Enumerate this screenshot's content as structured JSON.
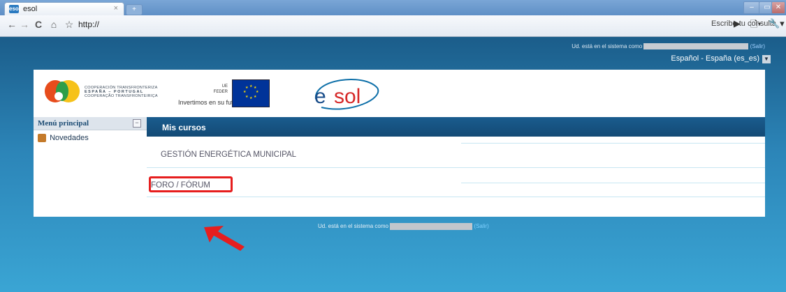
{
  "browser": {
    "tab_title": "esol",
    "tab_close": "×",
    "favicon_label": "esol",
    "url": "http://",
    "search_placeholder": "Escribe tu consulta"
  },
  "page": {
    "login_text": "Ud. está en el sistema como",
    "logout_label": "(Salir)",
    "language": "Español - España (es_es)",
    "header": {
      "coop_lines": [
        "COOPERACIÓN TRANSFRONTERIZA",
        "ESPAÑA – PORTUGAL",
        "COOPERAÇÃO TRANSFRONTEIRIÇA"
      ],
      "ue": "UE",
      "feder": "FEDER",
      "slogan": "Invertimos en su futuro",
      "esol_logo": "esol"
    },
    "sidebar": {
      "title": "Menú principal",
      "toggle": "−",
      "items": [
        {
          "label": "Novedades"
        }
      ]
    },
    "main": {
      "heading": "Mis cursos",
      "courses": [
        {
          "label": "GESTIÓN ENERGÉTICA MUNICIPAL"
        },
        {
          "label": "FORO / FÓRUM"
        }
      ]
    },
    "footer": {
      "login_text": "Ud. está en el sistema como",
      "logout_label": "(Salir)"
    }
  },
  "colors": {
    "annotation": "#e61e1e",
    "header_bar": "#1a5c8e"
  }
}
